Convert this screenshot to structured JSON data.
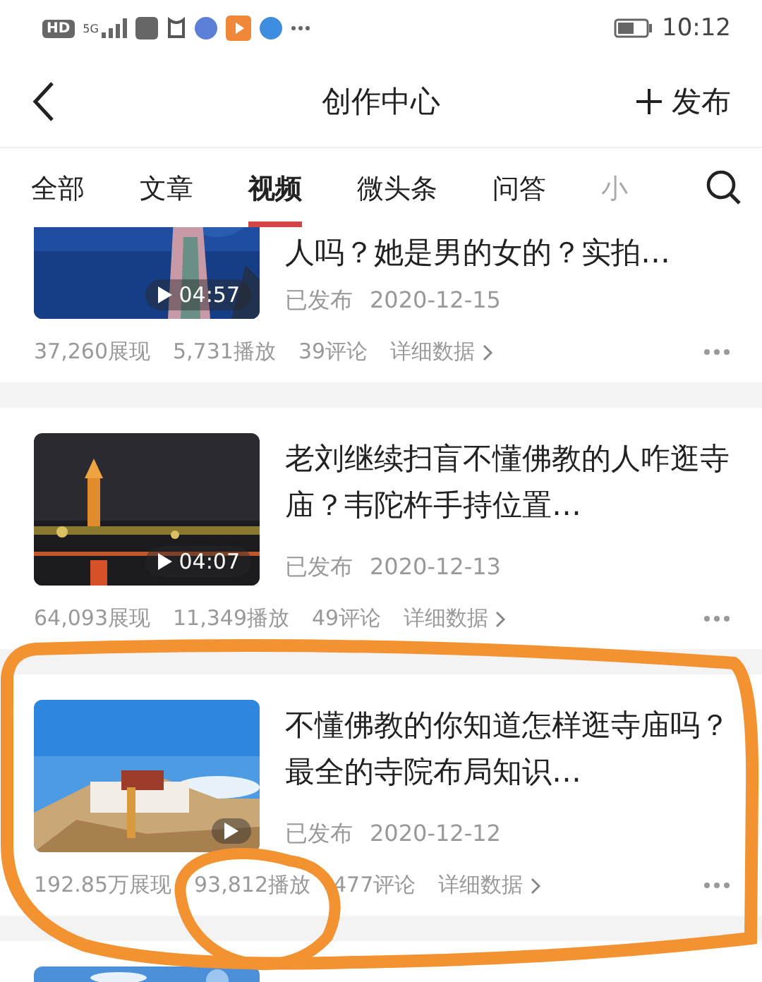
{
  "status_bar": {
    "hd": "HD",
    "network": "5G",
    "time": "10:12"
  },
  "header": {
    "title": "创作中心",
    "publish": "发布"
  },
  "tabs": [
    {
      "label": "全部",
      "selected": false
    },
    {
      "label": "文章",
      "selected": false
    },
    {
      "label": "视频",
      "selected": true
    },
    {
      "label": "微头条",
      "selected": false
    },
    {
      "label": "问答",
      "selected": false
    },
    {
      "label": "小",
      "selected": false,
      "faded": true
    }
  ],
  "videos": [
    {
      "title": "人吗？她是男的女的？实拍…",
      "duration": "04:57",
      "status": "已发布",
      "date": "2020-12-15",
      "impressions": "37,260展现",
      "plays": "5,731播放",
      "comments": "39评论",
      "details": "详细数据"
    },
    {
      "title": "老刘继续扫盲不懂佛教的人咋逛寺庙？韦陀杵手持位置…",
      "duration": "04:07",
      "status": "已发布",
      "date": "2020-12-13",
      "impressions": "64,093展现",
      "plays": "11,349播放",
      "comments": "49评论",
      "details": "详细数据"
    },
    {
      "title": "不懂佛教的你知道怎样逛寺庙吗？最全的寺院布局知识…",
      "status": "已发布",
      "date": "2020-12-12",
      "impressions": "192.85万展现",
      "plays": "93,812播放",
      "comments": "477评论",
      "details": "详细数据"
    }
  ]
}
